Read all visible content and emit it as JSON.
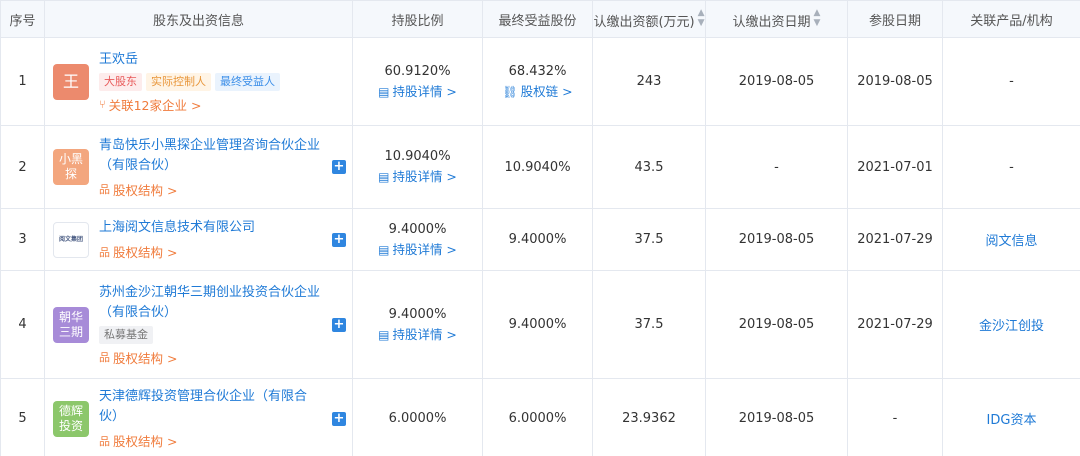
{
  "headers": {
    "index": "序号",
    "holder": "股东及出资信息",
    "ratio": "持股比例",
    "benefit": "最终受益股份",
    "amount": "认缴出资额(万元)",
    "date": "认缴出资日期",
    "join_date": "参股日期",
    "related": "关联产品/机构"
  },
  "rows": [
    {
      "index": "1",
      "avatar": "王",
      "avatar_color": "#ec8a6d",
      "name": "王欢岳",
      "tags": [
        "大股东",
        "实际控制人",
        "最终受益人"
      ],
      "sublink": "关联12家企业 >",
      "ratio": "60.9120%",
      "ratio_link": "持股详情 >",
      "benefit": "68.432%",
      "benefit_link": "股权链 >",
      "amount": "243",
      "date": "2019-08-05",
      "join_date": "2019-08-05",
      "related": "-"
    },
    {
      "index": "2",
      "avatar": "小黑 探",
      "avatar_color": "#f3a67e",
      "name": "青岛快乐小黑探企业管理咨询合伙企业（有限合伙）",
      "sublink": "股权结构 >",
      "ratio": "10.9040%",
      "ratio_link": "持股详情 >",
      "benefit": "10.9040%",
      "amount": "43.5",
      "date": "-",
      "join_date": "2021-07-01",
      "related": "-"
    },
    {
      "index": "3",
      "avatar": "阅文集团",
      "name": "上海阅文信息技术有限公司",
      "sublink": "股权结构 >",
      "ratio": "9.4000%",
      "ratio_link": "持股详情 >",
      "benefit": "9.4000%",
      "amount": "37.5",
      "date": "2019-08-05",
      "join_date": "2021-07-29",
      "related": "阅文信息"
    },
    {
      "index": "4",
      "avatar": "朝华 三期",
      "avatar_color": "#a78bd8",
      "name": "苏州金沙江朝华三期创业投资合伙企业（有限合伙）",
      "tags": [
        "私募基金"
      ],
      "sublink": "股权结构 >",
      "ratio": "9.4000%",
      "ratio_link": "持股详情 >",
      "benefit": "9.4000%",
      "amount": "37.5",
      "date": "2019-08-05",
      "join_date": "2021-07-29",
      "related": "金沙江创投"
    },
    {
      "index": "5",
      "avatar": "德辉 投资",
      "avatar_color": "#8cc76b",
      "name": "天津德辉投资管理合伙企业（有限合伙）",
      "sublink": "股权结构 >",
      "ratio": "6.0000%",
      "benefit": "6.0000%",
      "amount": "23.9362",
      "date": "2019-08-05",
      "join_date": "-",
      "related": "IDG资本"
    }
  ],
  "icons": {
    "sort": "sort-icon",
    "plus": "plus-icon",
    "detail": "document-icon",
    "chain": "chain-icon",
    "structure": "structure-icon",
    "related": "related-companies-icon"
  }
}
